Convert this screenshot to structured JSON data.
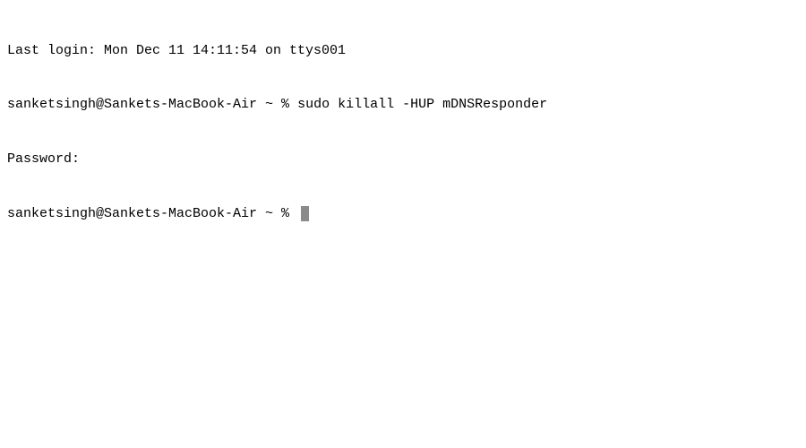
{
  "terminal": {
    "lines": [
      {
        "text": "Last login: Mon Dec 11 14:11:54 on ttys001"
      },
      {
        "prompt": "sanketsingh@Sankets-MacBook-Air ~ % ",
        "command": "sudo killall -HUP mDNSResponder"
      },
      {
        "text": "Password:"
      }
    ],
    "current_prompt": "sanketsingh@Sankets-MacBook-Air ~ % "
  }
}
